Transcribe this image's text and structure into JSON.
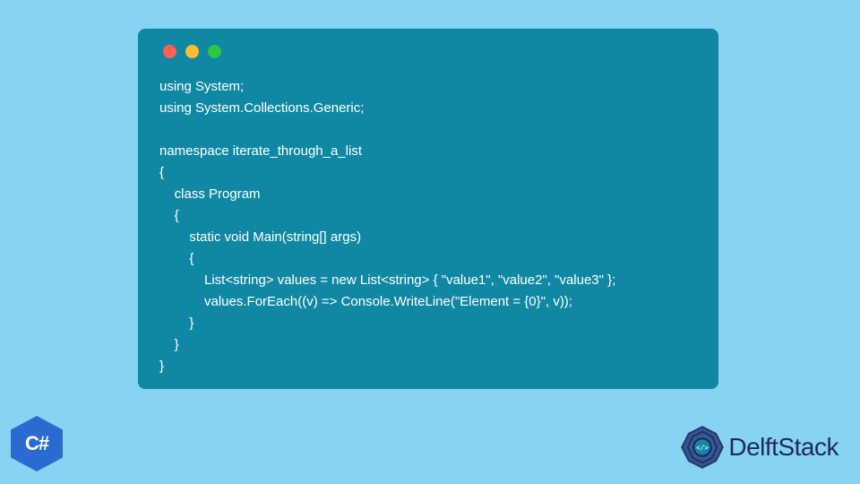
{
  "code": {
    "line1": "using System;",
    "line2": "using System.Collections.Generic;",
    "line3": "",
    "line4": "namespace iterate_through_a_list",
    "line5": "{",
    "line6": "    class Program",
    "line7": "    {",
    "line8": "        static void Main(string[] args)",
    "line9": "        {",
    "line10": "            List<string> values = new List<string> { \"value1\", \"value2\", \"value3\" };",
    "line11": "            values.ForEach((v) => Console.WriteLine(\"Element = {0}\", v));",
    "line12": "        }",
    "line13": "    }",
    "line14": "}"
  },
  "badges": {
    "csharp": "C#",
    "delftstack": "DelftStack"
  },
  "colors": {
    "background": "#87d3f2",
    "window": "#1188a3",
    "csharp_badge": "#2b6bd1",
    "logo_text": "#1e2a5a"
  }
}
